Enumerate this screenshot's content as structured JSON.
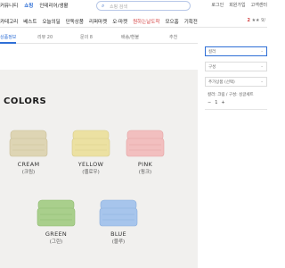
{
  "top_nav": {
    "items": [
      "커뮤니티",
      "쇼핑",
      "인테리어/생활"
    ],
    "active_index": 1
  },
  "search": {
    "placeholder": "쇼핑 검색"
  },
  "user_links": [
    "로그인",
    "회원가입",
    "고객센터"
  ],
  "categories": {
    "items": [
      "카테고리",
      "베스트",
      "오늘의딜",
      "단독상품",
      "리퍼마켓",
      "오·마켓",
      "원하는날도착",
      "모으홈",
      "기획전"
    ],
    "right_count": "2",
    "right_text": "★★ 9/"
  },
  "tabs": [
    {
      "label": "상품정보",
      "active": true
    },
    {
      "label": "리뷰 20",
      "active": false
    },
    {
      "label": "문의 8",
      "active": false
    },
    {
      "label": "배송/환불",
      "active": false
    },
    {
      "label": "추천",
      "active": false
    }
  ],
  "section_title": "COLORS",
  "products": [
    {
      "name": "CREAM",
      "korean": "(크림)",
      "color": "#ded5b4",
      "shade": "#c9bf98"
    },
    {
      "name": "YELLOW",
      "korean": "(옐로우)",
      "color": "#ece1a2",
      "shade": "#d8cc88"
    },
    {
      "name": "PINK",
      "korean": "(핑크)",
      "color": "#f2bfbf",
      "shade": "#e3a3a3"
    },
    {
      "name": "GREEN",
      "korean": "(그린)",
      "color": "#a9cf8c",
      "shade": "#8fbb71"
    },
    {
      "name": "BLUE",
      "korean": "(블루)",
      "color": "#a7c5ec",
      "shade": "#8cafdc"
    }
  ],
  "side": {
    "color_select": "컬러",
    "size_select": "구성",
    "extra_select": "추가상품 (선택)",
    "option_line": "컬러: 크림 / 구성: 싱글세트",
    "quantity": "1",
    "minus": "−",
    "plus": "+",
    "caret": "⌄"
  }
}
